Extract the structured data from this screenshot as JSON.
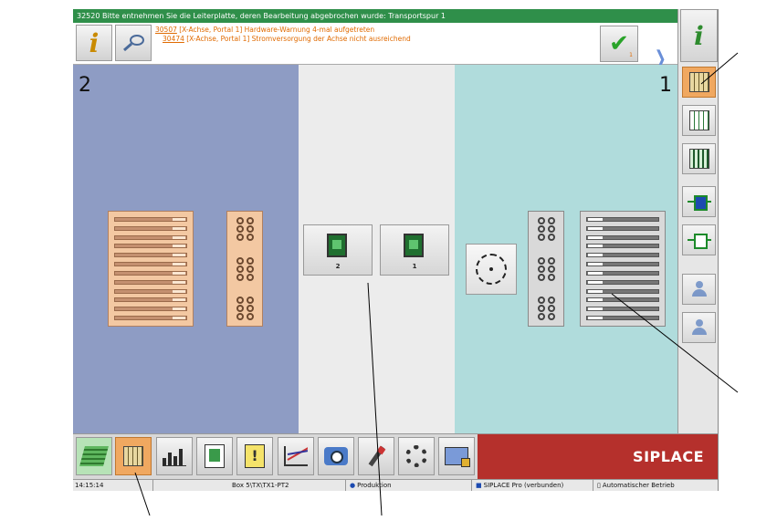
{
  "titlebar": {
    "text": "32520 Bitte entnehmen Sie die Leiterplatte, deren Bearbeitung abgebrochen wurde: Transportspur 1"
  },
  "messages": [
    {
      "code": "30507",
      "text": " [X-Achse, Portal 1] Hardware-Warnung 4-mal aufgetreten"
    },
    {
      "code": "30474",
      "text": " [X-Achse, Portal 1] Stromversorgung der Achse nicht ausreichend"
    }
  ],
  "toolbar": {
    "info_icon": "info-icon",
    "confirm_badge": "1",
    "help_icon": "help-info-icon"
  },
  "zones": {
    "left_label": "2",
    "right_label": "1"
  },
  "conveyor_buttons": [
    {
      "label": "2"
    },
    {
      "label": "1"
    }
  ],
  "sidebar": {
    "items": [
      {
        "icon": "feeder-view-icon",
        "active": true
      },
      {
        "icon": "feeder-list-icon",
        "active": false
      },
      {
        "icon": "feeder-table-icon",
        "active": false
      },
      {
        "icon": "conveyor-top-icon",
        "active": false
      },
      {
        "icon": "conveyor-icon",
        "active": false
      },
      {
        "icon": "user-lock-icon",
        "active": false
      },
      {
        "icon": "user-settings-icon",
        "active": false
      }
    ]
  },
  "taskbar": {
    "items": [
      {
        "icon": "stack-icon"
      },
      {
        "icon": "feeder-grid-icon",
        "active": true
      },
      {
        "icon": "bar-chart-icon"
      },
      {
        "icon": "board-doc-icon"
      },
      {
        "icon": "warning-doc-icon"
      },
      {
        "icon": "trend-chart-icon"
      },
      {
        "icon": "camera-icon"
      },
      {
        "icon": "tool-icon"
      },
      {
        "icon": "gear-hand-icon"
      },
      {
        "icon": "locked-settings-icon"
      }
    ],
    "brand": "SIPLACE"
  },
  "statusbar": {
    "time": "14:15:14",
    "path": "Box 5\\TX\\TX1-PT2",
    "mode": "Produktion",
    "connection": "SIPLACE Pro (verbunden)",
    "operation": "Automatischer Betrieb"
  },
  "colors": {
    "titlebar": "#2f8f4a",
    "warning_text": "#e06a00",
    "left_zone": "#8e9cc4",
    "right_zone": "#b0dcdc",
    "active_tab": "#f0a860",
    "brand_bar": "#b5302c"
  }
}
